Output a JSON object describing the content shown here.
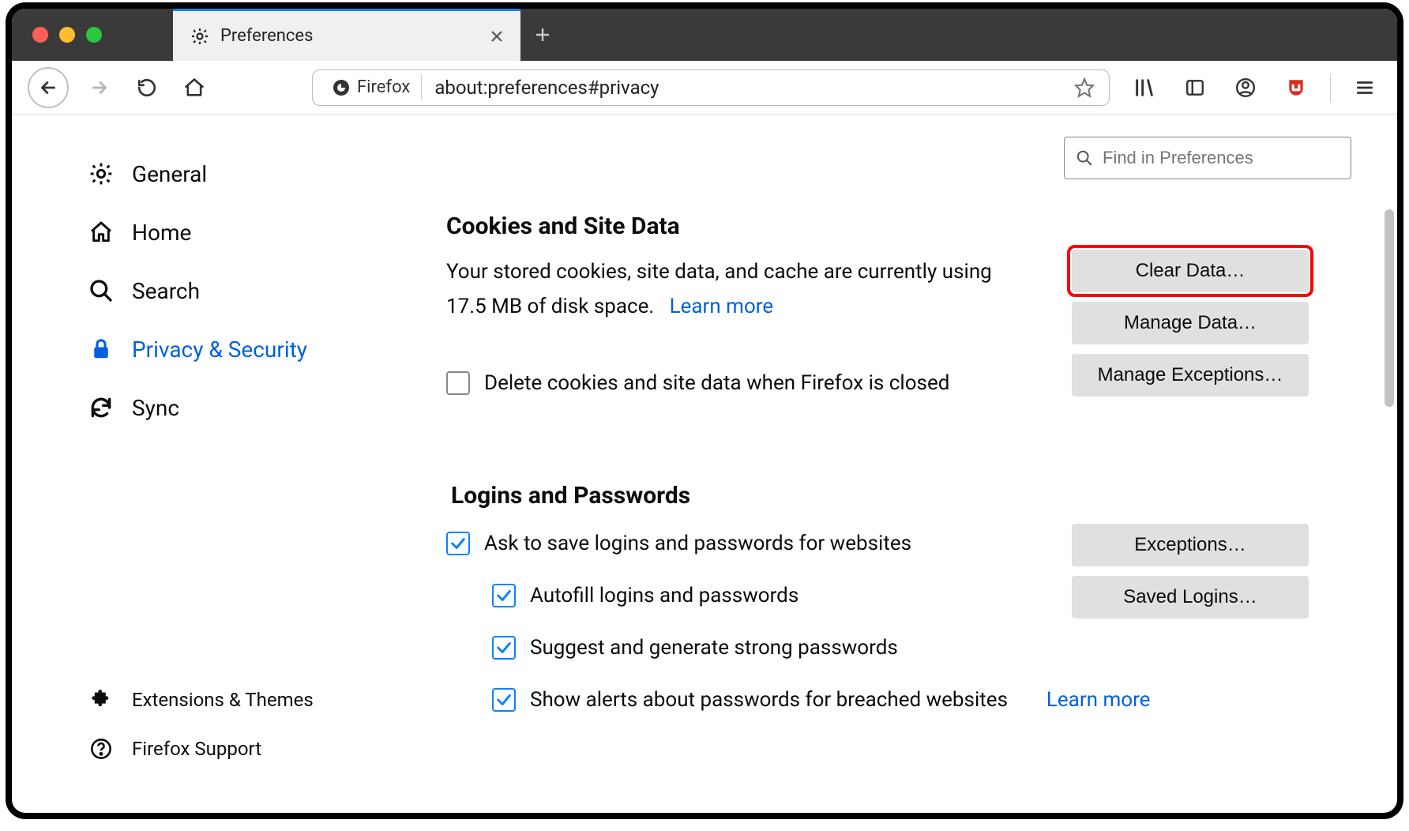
{
  "tab": {
    "title": "Preferences"
  },
  "url": {
    "identity": "Firefox",
    "path": "about:preferences#privacy"
  },
  "search": {
    "placeholder": "Find in Preferences"
  },
  "sidebar": {
    "general": "General",
    "home": "Home",
    "search": "Search",
    "privacy": "Privacy & Security",
    "sync": "Sync",
    "extensions": "Extensions & Themes",
    "support": "Firefox Support"
  },
  "cookies": {
    "heading": "Cookies and Site Data",
    "desc_prefix": "Your stored cookies, site data, and cache are currently using 17.5 MB of disk space.",
    "learn_more": "Learn more",
    "delete_on_close": "Delete cookies and site data when Firefox is closed",
    "clear_data": "Clear Data…",
    "manage_data": "Manage Data…",
    "manage_exceptions": "Manage Exceptions…"
  },
  "logins": {
    "heading": "Logins and Passwords",
    "ask_save": "Ask to save logins and passwords for websites",
    "autofill": "Autofill logins and passwords",
    "suggest": "Suggest and generate strong passwords",
    "breach": "Show alerts about passwords for breached websites",
    "learn_more": "Learn more",
    "exceptions": "Exceptions…",
    "saved_logins": "Saved Logins…"
  }
}
